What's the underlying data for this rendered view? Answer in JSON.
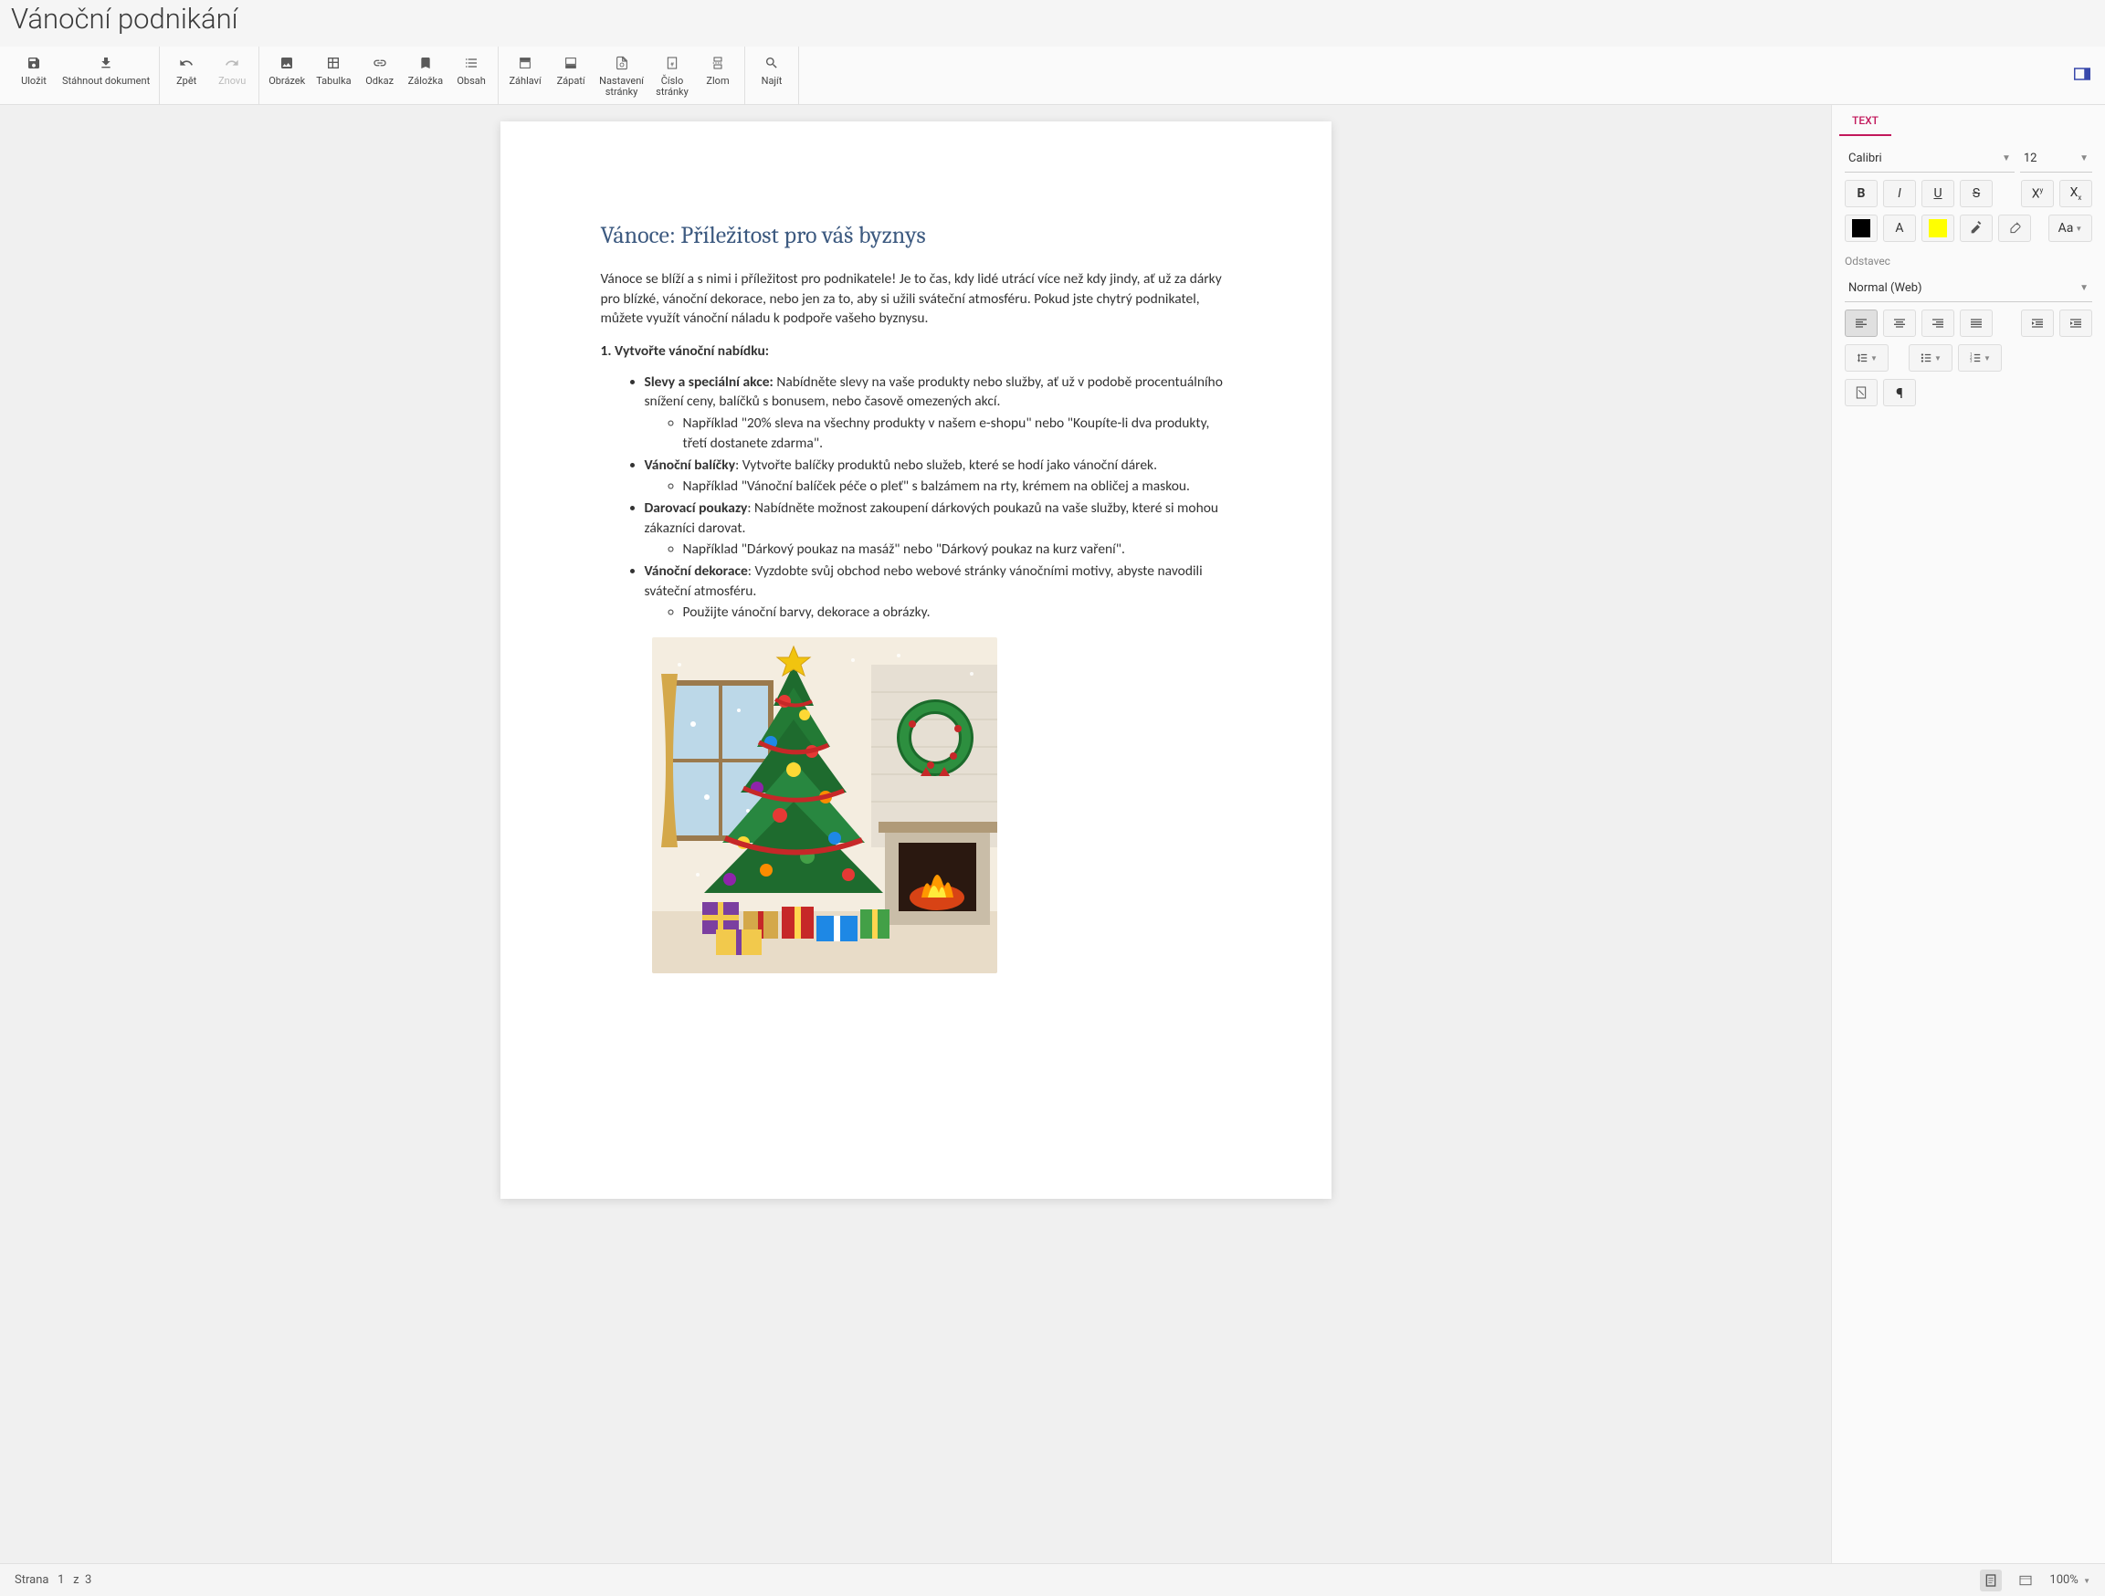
{
  "app_title": "Vánoční podnikání",
  "toolbar": {
    "save": "Uložit",
    "download": "Stáhnout dokument",
    "undo": "Zpět",
    "redo": "Znovu",
    "image": "Obrázek",
    "table": "Tabulka",
    "link": "Odkaz",
    "bookmark": "Záložka",
    "toc": "Obsah",
    "header": "Záhlaví",
    "footer": "Zápatí",
    "page_setup": "Nastavení\nstránky",
    "page_number": "Číslo\nstránky",
    "break": "Zlom",
    "find": "Najít"
  },
  "sidebar": {
    "tab_text": "TEXT",
    "font_family": "Calibri",
    "font_size": "12",
    "bold": "B",
    "italic": "I",
    "sup": "X",
    "sub": "X",
    "font_color_letter": "A",
    "case_label": "Aa",
    "paragraph_label": "Odstavec",
    "paragraph_style": "Normal (Web)"
  },
  "document": {
    "heading": "Vánoce: Příležitost pro váš byznys",
    "intro": "Vánoce se blíží a s nimi i příležitost pro podnikatele! Je to čas, kdy lidé utrácí více než kdy jindy, ať už za dárky pro blízké, vánoční dekorace, nebo jen za to, aby si užili sváteční atmosféru. Pokud jste chytrý podnikatel, můžete využít vánoční náladu k podpoře vašeho byznysu.",
    "h1": "1. Vytvořte vánoční nabídku:",
    "items": {
      "i0_b": "Slevy a speciální akce:",
      "i0_t": " Nabídněte slevy na vaše produkty nebo služby, ať už v podobě procentuálního snížení ceny, balíčků s bonusem, nebo časově omezených akcí.",
      "i0_sub": "Například \"20% sleva na všechny produkty v našem e-shopu\" nebo \"Koupíte-li dva produkty, třetí dostanete zdarma\".",
      "i1_b": "Vánoční balíčky",
      "i1_t": ": Vytvořte balíčky produktů nebo služeb, které se hodí jako vánoční dárek.",
      "i1_sub": "Například \"Vánoční balíček péče o pleť\" s balzámem na rty, krémem na obličej a maskou.",
      "i2_b": "Darovací poukazy",
      "i2_t": ": Nabídněte možnost zakoupení dárkových poukazů na vaše služby, které si mohou zákazníci darovat.",
      "i2_sub": "Například \"Dárkový poukaz na masáž\" nebo \"Dárkový poukaz na kurz vaření\".",
      "i3_b": "Vánoční dekorace",
      "i3_t": ": Vyzdobte svůj obchod nebo webové stránky vánočními motivy, abyste navodili sváteční atmosféru.",
      "i3_sub": "Použijte vánoční barvy, dekorace a obrázky."
    }
  },
  "statusbar": {
    "page_label": "Strana",
    "page_current": "1",
    "page_of": "z",
    "page_total": "3",
    "zoom": "100%"
  }
}
